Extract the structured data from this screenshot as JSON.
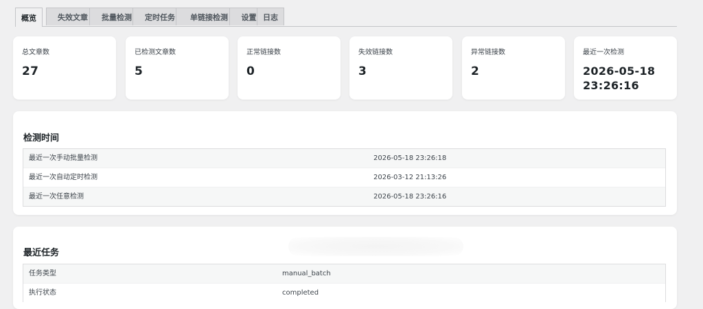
{
  "tabs": [
    {
      "label": "概览"
    },
    {
      "label": "失效文章"
    },
    {
      "label": "批量检测"
    },
    {
      "label": "定时任务"
    },
    {
      "label": "单链接检测"
    },
    {
      "label": "设置"
    },
    {
      "label": "日志"
    }
  ],
  "stats": [
    {
      "label": "总文章数",
      "value": "27"
    },
    {
      "label": "已检测文章数",
      "value": "5"
    },
    {
      "label": "正常链接数",
      "value": "0"
    },
    {
      "label": "失效链接数",
      "value": "3"
    },
    {
      "label": "异常链接数",
      "value": "2"
    },
    {
      "label": "最近一次检测",
      "value_line1": "2026-05-18",
      "value_line2": "23:26:16"
    }
  ],
  "check_times": {
    "title": "检测时间",
    "rows": [
      {
        "label": "最近一次手动批量检测",
        "value": "2026-05-18 23:26:18"
      },
      {
        "label": "最近一次自动定时检测",
        "value": "2026-03-12 21:13:26"
      },
      {
        "label": "最近一次任意检测",
        "value": "2026-05-18 23:26:16"
      }
    ]
  },
  "recent_task": {
    "title": "最近任务",
    "rows": [
      {
        "label": "任务类型",
        "value": "manual_batch"
      },
      {
        "label": "执行状态",
        "value": "completed"
      }
    ]
  }
}
